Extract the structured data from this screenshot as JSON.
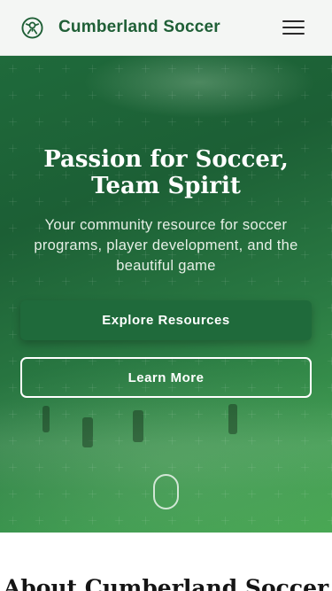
{
  "header": {
    "logo_icon": "soccer-ball-icon",
    "brand_name": "Cumberland Soccer",
    "menu_icon": "hamburger-menu-icon"
  },
  "hero": {
    "title_line1": "Passion for Soccer,",
    "title_line2": "Team Spirit",
    "subtitle": "Your community resource for soccer programs, player development, and the beautiful game",
    "primary_button": "Explore Resources",
    "secondary_button": "Learn More",
    "scroll_icon": "scroll-down-mouse-icon"
  },
  "about": {
    "title": "About Cumberland Soccer"
  },
  "colors": {
    "brand_green": "#1f5f36",
    "hero_green_dark": "#1c5f35",
    "hero_green_light": "#47a752",
    "button_green": "#1f6a3b"
  }
}
